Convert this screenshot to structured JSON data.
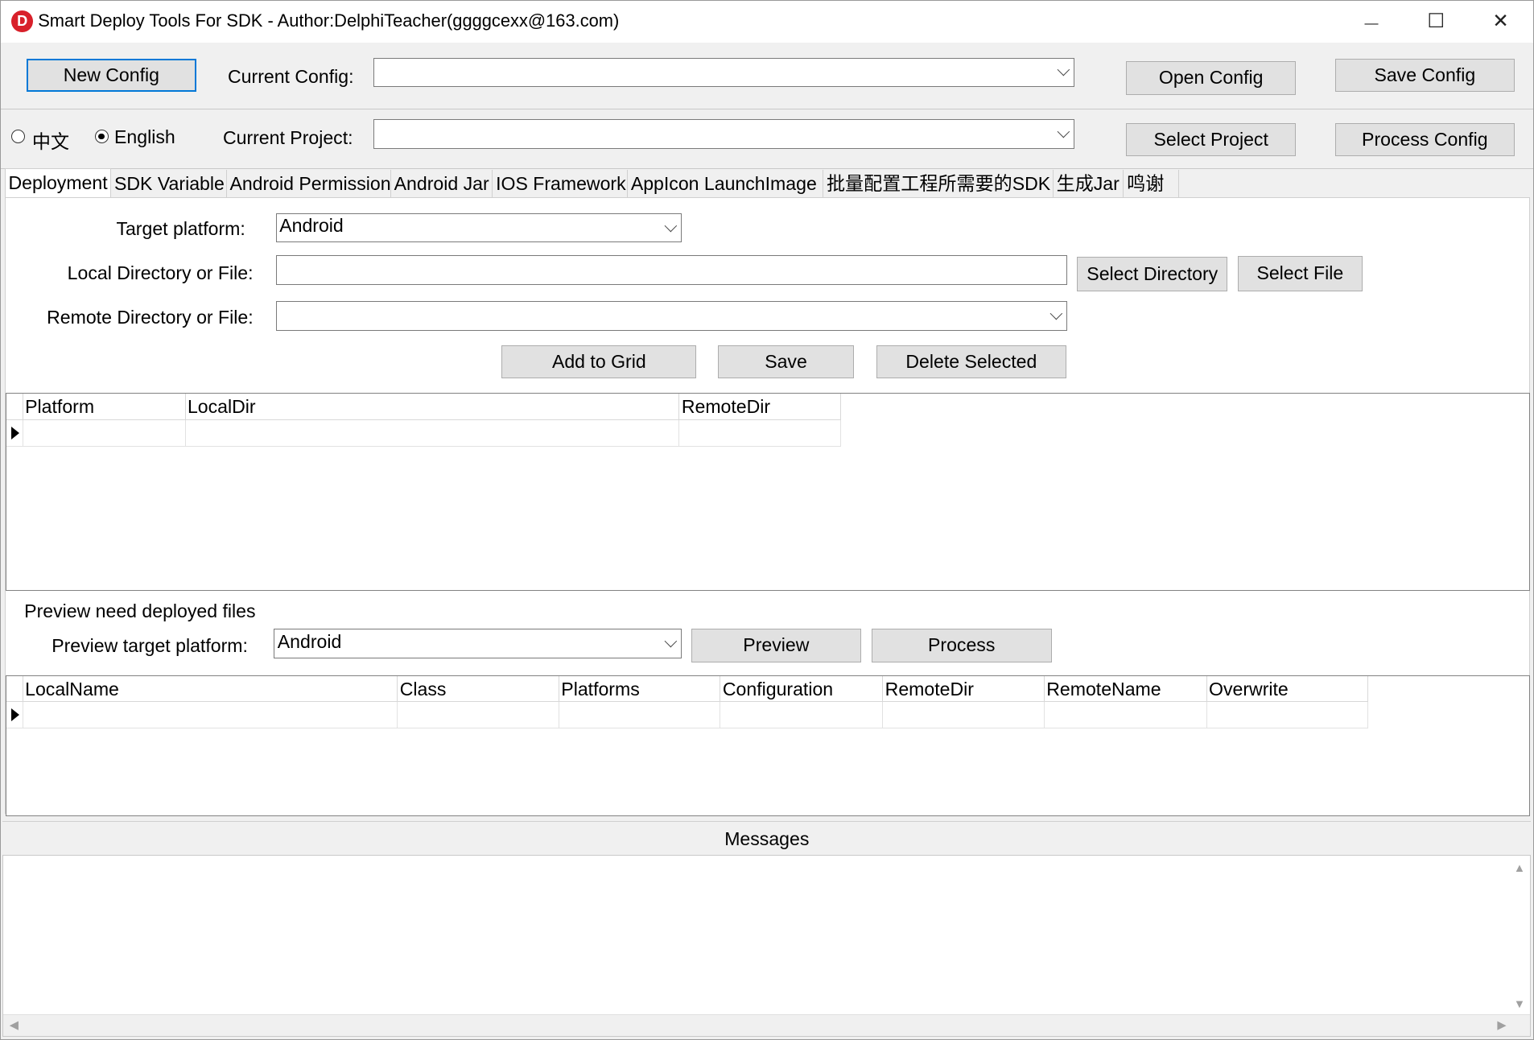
{
  "window": {
    "title": "Smart Deploy Tools For SDK - Author:DelphiTeacher(ggggcexx@163.com)",
    "app_icon_letter": "D",
    "minimize_glyph": "—",
    "maximize_glyph": "☐",
    "close_glyph": "✕"
  },
  "config_row": {
    "new_config": "New Config",
    "current_config_label": "Current Config:",
    "current_config_value": "",
    "open_config": "Open Config",
    "save_config": "Save Config"
  },
  "project_row": {
    "lang_chinese": "中文",
    "lang_english": "English",
    "selected_language": "English",
    "current_project_label": "Current Project:",
    "current_project_value": "",
    "select_project": "Select Project",
    "process_config": "Process Config"
  },
  "tabs": [
    {
      "label": "Deployment",
      "active": true
    },
    {
      "label": "SDK Variable"
    },
    {
      "label": "Android Permission"
    },
    {
      "label": "Android Jar"
    },
    {
      "label": "IOS Framework"
    },
    {
      "label": "AppIcon LaunchImage"
    },
    {
      "label": "批量配置工程所需要的SDK"
    },
    {
      "label": "生成Jar"
    },
    {
      "label": "鸣谢"
    }
  ],
  "deployment": {
    "target_platform_label": "Target platform:",
    "target_platform_value": "Android",
    "local_dir_label": "Local Directory or File:",
    "local_dir_value": "",
    "select_directory": "Select Directory",
    "select_file": "Select File",
    "remote_dir_label": "Remote Directory or File:",
    "remote_dir_value": "",
    "add_to_grid": "Add to Grid",
    "save": "Save",
    "delete_selected": "Delete Selected",
    "grid_columns": [
      "Platform",
      "LocalDir",
      "RemoteDir"
    ],
    "preview_heading": "Preview need deployed files",
    "preview_platform_label": "Preview target platform:",
    "preview_platform_value": "Android",
    "preview": "Preview",
    "process": "Process",
    "preview_columns": [
      "LocalName",
      "Class",
      "Platforms",
      "Configuration",
      "RemoteDir",
      "RemoteName",
      "Overwrite"
    ]
  },
  "messages": {
    "title": "Messages",
    "content": ""
  }
}
